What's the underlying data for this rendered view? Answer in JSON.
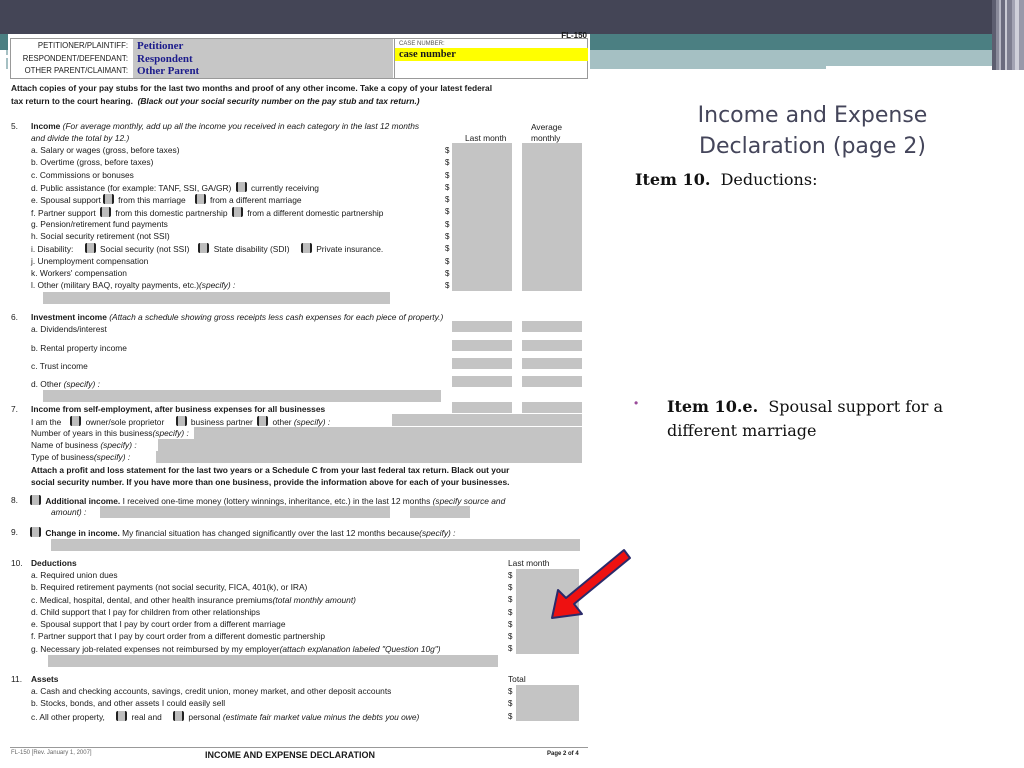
{
  "slide": {
    "title_line1": "Income and Expense",
    "title_line2": "Declaration (page 2)",
    "item_heading_bold": "Item 10.",
    "item_heading_text": "Deductions:",
    "bullet_symbol": "•",
    "bullet_bold": "Item 10.e.",
    "bullet_text": "Spousal support for a different marriage",
    "colors": {
      "header_dark": "#444556",
      "header_teal": "#4b7f82",
      "header_light": "#a5c0c3",
      "title_text": "#44455a",
      "bullet": "#9a4c9a",
      "arrow_fill": "#ee1111",
      "arrow_outline": "#2a2a6a"
    }
  },
  "form": {
    "form_number": "FL-150",
    "caption": {
      "petitioner_label": "PETITIONER/PLAINTIFF:",
      "respondent_label": "RESPONDENT/DEFENDANT:",
      "other_label": "OTHER PARENT/CLAIMANT:",
      "petitioner_value": "Petitioner",
      "respondent_value": "Respondent",
      "other_value": "Other Parent",
      "case_number_label": "CASE NUMBER:",
      "case_number_value": "case number"
    },
    "intro_line1": "Attach copies of your pay stubs for the last two months and proof of any other income. Take a copy of your latest federal",
    "intro_line2a": "tax return to the court hearing.",
    "intro_line2b": "(Black out your social security number on the pay stub and tax return.)",
    "s5": {
      "num": "5.",
      "title": "Income",
      "note1": "(For average monthly, add up all the income you received in each category in the last 12 months",
      "note2": "and divide the total by 12.)",
      "col_last": "Last month",
      "col_avg1": "Average",
      "col_avg2": "monthly",
      "a": "a.  Salary or wages (gross, before taxes)",
      "b": "b.  Overtime (gross, before taxes)",
      "c": "c.  Commissions or bonuses",
      "d1": "d.  Public assistance (for example: TANF, SSI, GA/GR)",
      "d2": "currently receiving",
      "e1": "e.  Spousal support",
      "e2": "from this marriage",
      "e3": "from a different marriage",
      "f1": "f.   Partner support",
      "f2": "from this domestic partnership",
      "f3": "from a different domestic partnership",
      "g": "g.  Pension/retirement fund payments",
      "h": "h.  Social security retirement (not SSI)",
      "i1": "i.   Disability:",
      "i2": "Social security (not SSI)",
      "i3": "State disability (SDI)",
      "i4": "Private insurance.",
      "j": "j.   Unemployment compensation",
      "k": "k.  Workers' compensation",
      "l1": "l.   Other (military BAQ, royalty payments, etc.)",
      "l2": "(specify) :"
    },
    "s6": {
      "num": "6.",
      "title": "Investment income",
      "note": "(Attach a schedule showing gross receipts less cash expenses for each piece of property.)",
      "a": "a.  Dividends/interest",
      "b": "b.  Rental property income",
      "c": "c.  Trust income",
      "d1": "d.  Other",
      "d2": "(specify) :"
    },
    "s7": {
      "num": "7.",
      "title": "Income from self-employment, after business expenses for all businesses",
      "iam": "I am the",
      "opt1": "owner/sole proprietor",
      "opt2": "business partner",
      "opt3": "other",
      "specify": "(specify) :",
      "years": "Number of years in this business",
      "name": "Name of business",
      "type": "Type of business",
      "attach1": "Attach a profit and loss statement for the last two years or a Schedule C from your last federal tax return. Black out your",
      "attach2": "social security number. If you have more than one business, provide the information above for each of your businesses."
    },
    "s8": {
      "num": "8.",
      "title": "Additional income.",
      "text": "I received one-time money (lottery winnings, inheritance, etc.) in the last 12 months",
      "note1": "(specify source and",
      "note2": "amount) :"
    },
    "s9": {
      "num": "9.",
      "title": "Change in income.",
      "text": "My financial situation has changed significantly over the last 12 months because",
      "note": "(specify) :"
    },
    "s10": {
      "num": "10.",
      "title": "Deductions",
      "col": "Last month",
      "a": "a.  Required union dues",
      "b": "b.  Required retirement payments (not social security, FICA, 401(k), or IRA)",
      "c1": "c.  Medical, hospital, dental, and other health insurance premiums",
      "c2": "(total monthly amount)",
      "d": "d.  Child support that I pay for children from other relationships",
      "e": "e.  Spousal support that I pay by court order from a different marriage",
      "f": "f.   Partner support that I pay by court order from a different domestic partnership",
      "g1": "g.  Necessary job-related expenses not reimbursed by my employer",
      "g2": "(attach explanation labeled \"Question 10g\")"
    },
    "s11": {
      "num": "11.",
      "title": "Assets",
      "col": "Total",
      "a": "a.  Cash and checking accounts, savings, credit union, money market, and other deposit accounts",
      "b": "b.  Stocks, bonds, and other assets I could easily sell",
      "c1": "c.  All other property,",
      "c2": "real and",
      "c3": "personal",
      "c4": "(estimate fair market value minus the debts you owe)"
    },
    "dollar": "$",
    "footer": {
      "rev": "FL-150 [Rev. January 1, 2007]",
      "title": "INCOME AND EXPENSE DECLARATION",
      "page": "Page 2 of 4"
    }
  }
}
